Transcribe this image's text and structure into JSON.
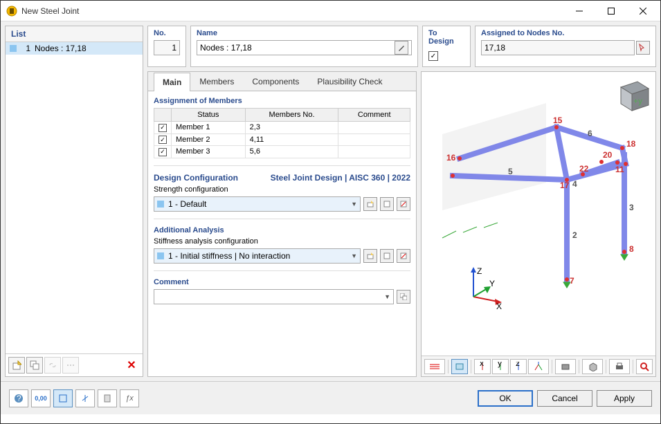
{
  "window": {
    "title": "New Steel Joint"
  },
  "list": {
    "header": "List",
    "items": [
      {
        "num": "1",
        "label": "Nodes : 17,18"
      }
    ]
  },
  "fields": {
    "no_label": "No.",
    "no_value": "1",
    "name_label": "Name",
    "name_value": "Nodes : 17,18",
    "todesign_label": "To Design",
    "todesign_checked": "✓",
    "assigned_label": "Assigned to Nodes No.",
    "assigned_value": "17,18"
  },
  "tabs": {
    "main": "Main",
    "members": "Members",
    "components": "Components",
    "plausibility": "Plausibility Check"
  },
  "sections": {
    "assignment": {
      "title": "Assignment of Members",
      "cols": {
        "status": "Status",
        "members_no": "Members No.",
        "comment": "Comment"
      },
      "rows": [
        {
          "checked": "✓",
          "status": "Member 1",
          "members_no": "2,3",
          "comment": ""
        },
        {
          "checked": "✓",
          "status": "Member 2",
          "members_no": "4,11",
          "comment": ""
        },
        {
          "checked": "✓",
          "status": "Member 3",
          "members_no": "5,6",
          "comment": ""
        }
      ]
    },
    "design_config": {
      "title": "Design Configuration",
      "right": "Steel Joint Design | AISC 360 | 2022",
      "sub": "Strength configuration",
      "value": "1 - Default"
    },
    "additional": {
      "title": "Additional Analysis",
      "sub": "Stiffness analysis configuration",
      "value": "1 - Initial stiffness | No interaction"
    },
    "comment": {
      "title": "Comment",
      "value": ""
    }
  },
  "view3d": {
    "node_labels": [
      "15",
      "6",
      "18",
      "16",
      "20",
      "22",
      "11",
      "5",
      "17",
      "4",
      "3",
      "2",
      "8",
      "7"
    ],
    "axes": {
      "x": "X",
      "y": "Y",
      "z": "Z"
    }
  },
  "footer": {
    "ok": "OK",
    "cancel": "Cancel",
    "apply": "Apply"
  }
}
